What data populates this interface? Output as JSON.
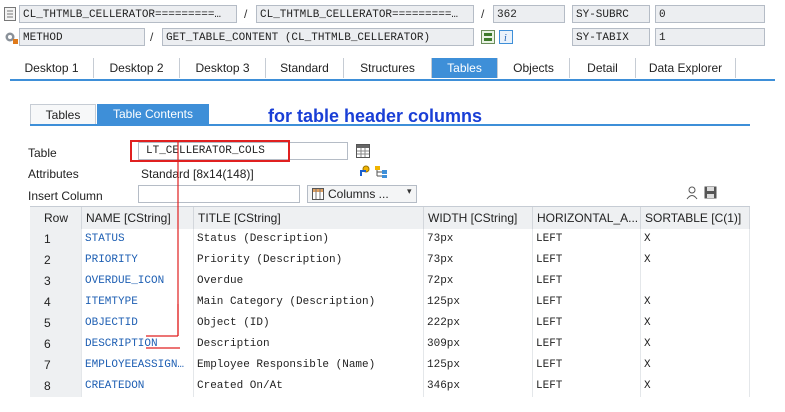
{
  "top": {
    "row1": {
      "field1": "CL_THTMLB_CELLERATOR=========…",
      "sep1": "/",
      "field2": "CL_THTMLB_CELLERATOR=========…",
      "sep2": "/",
      "line": "362",
      "sysvar": "SY-SUBRC",
      "sysval": "0"
    },
    "row2": {
      "type": "METHOD",
      "sep": "/",
      "method": "GET_TABLE_CONTENT (CL_THTMLB_CELLERATOR)",
      "sysvar": "SY-TABIX",
      "sysval": "1"
    }
  },
  "tabs": [
    {
      "label": "Desktop 1"
    },
    {
      "label": "Desktop 2"
    },
    {
      "label": "Desktop 3"
    },
    {
      "label": "Standard"
    },
    {
      "label": "Structures"
    },
    {
      "label": "Tables"
    },
    {
      "label": "Objects"
    },
    {
      "label": "Detail"
    },
    {
      "label": "Data Explorer"
    }
  ],
  "subtabs": [
    {
      "label": "Tables"
    },
    {
      "label": "Table Contents"
    }
  ],
  "annotation": "for table header columns",
  "form": {
    "table_label": "Table",
    "table_value": "LT_CELLERATOR_COLS",
    "attributes_label": "Attributes",
    "attributes_value": "Standard [8x14(148)]",
    "insert_label": "Insert Column",
    "columns_button": "Columns ..."
  },
  "grid": {
    "headers": [
      "Row",
      "NAME [CString]",
      "TITLE [CString]",
      "WIDTH [CString]",
      "HORIZONTAL_A...",
      "SORTABLE [C(1)]"
    ],
    "rows": [
      [
        "1",
        "STATUS",
        "Status (Description)",
        "73px",
        "LEFT",
        "X"
      ],
      [
        "2",
        "PRIORITY",
        "Priority (Description)",
        "73px",
        "LEFT",
        "X"
      ],
      [
        "3",
        "OVERDUE_ICON",
        "Overdue",
        "72px",
        "LEFT",
        ""
      ],
      [
        "4",
        "ITEMTYPE",
        "Main Category (Description)",
        "125px",
        "LEFT",
        "X"
      ],
      [
        "5",
        "OBJECTID",
        "Object (ID)",
        "222px",
        "LEFT",
        "X"
      ],
      [
        "6",
        "DESCRIPTION",
        "Description",
        "309px",
        "LEFT",
        "X"
      ],
      [
        "7",
        "EMPLOYEEASSIGN…",
        "Employee Responsible (Name)",
        "125px",
        "LEFT",
        "X"
      ],
      [
        "8",
        "CREATEDON",
        "Created On/At",
        "346px",
        "LEFT",
        "X"
      ]
    ]
  },
  "colors": {
    "accent": "#3e8fd8",
    "annotation": "#1a3fd6",
    "highlight_box": "#e02020",
    "name_text": "#1e5fb3"
  }
}
